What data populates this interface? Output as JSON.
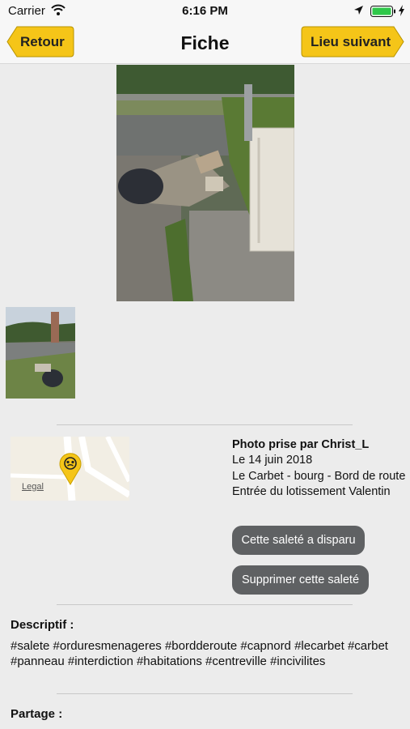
{
  "status_bar": {
    "carrier": "Carrier",
    "time": "6:16 PM"
  },
  "nav": {
    "title": "Fiche",
    "back_label": "Retour",
    "next_label": "Lieu suivant",
    "accent_color": "#f5c518"
  },
  "map": {
    "legal": "Legal"
  },
  "info": {
    "author": "Photo prise par Christ_L",
    "date": "Le 14 juin 2018",
    "place": "Le Carbet - bourg - Bord de route Entrée du lotissement Valentin"
  },
  "actions": {
    "disappeared": "Cette saleté a disparu",
    "delete": "Supprimer cette saleté"
  },
  "description": {
    "heading": "Descriptif :",
    "text": "#salete #orduresmenageres #bordderoute #capnord #lecarbet #carbet #panneau #interdiction #habitations #centreville #incivilites"
  },
  "share": {
    "heading": "Partage :"
  }
}
